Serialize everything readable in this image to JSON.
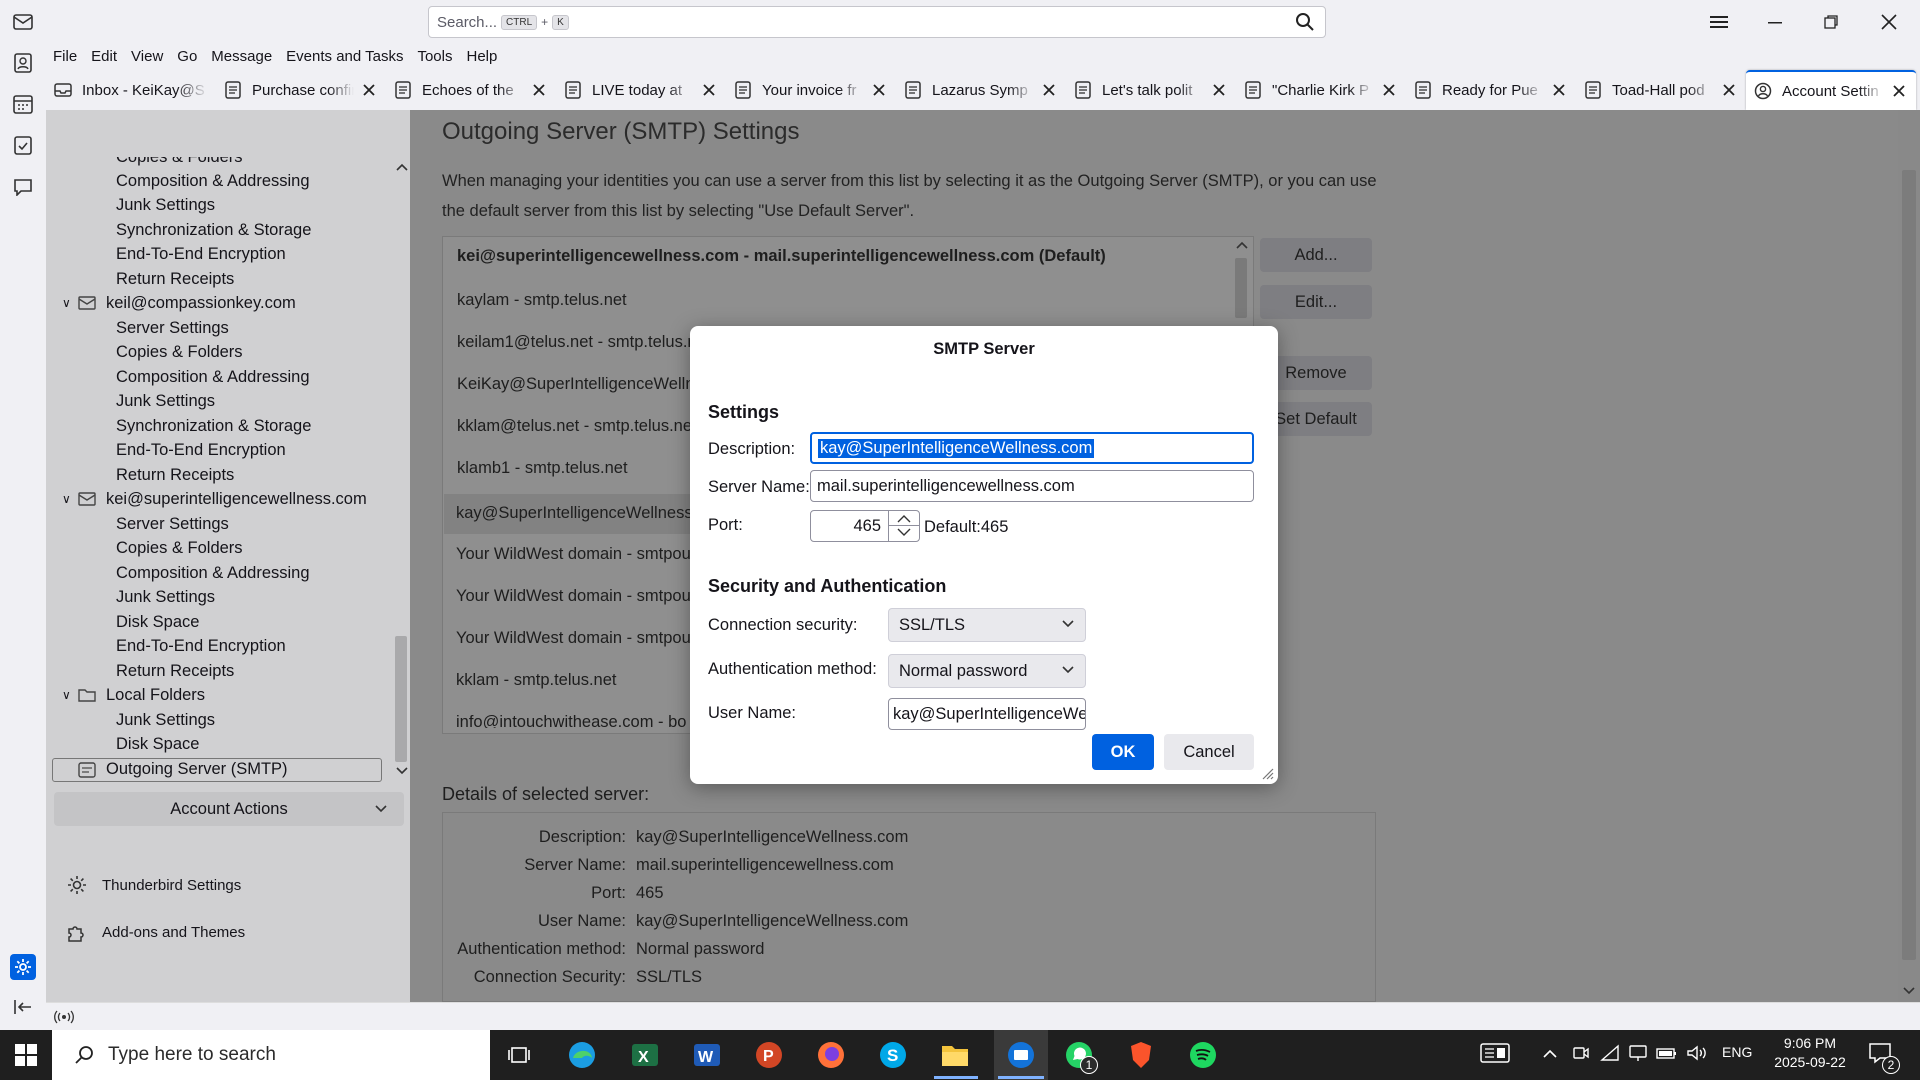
{
  "titlebar": {
    "search_placeholder": "Search...",
    "kbd_ctrl": "CTRL",
    "kbd_plus": "+",
    "kbd_k": "K"
  },
  "menu": [
    "File",
    "Edit",
    "View",
    "Go",
    "Message",
    "Events and Tasks",
    "Tools",
    "Help"
  ],
  "tabs": [
    {
      "label": "Inbox - KeiKay@S",
      "icon": "mail-icon"
    },
    {
      "label": "Purchase confirm",
      "icon": "message-icon"
    },
    {
      "label": "Echoes of the",
      "icon": "message-icon"
    },
    {
      "label": "LIVE today at",
      "icon": "message-icon"
    },
    {
      "label": "Your invoice fr",
      "icon": "message-icon"
    },
    {
      "label": "Lazarus Symp",
      "icon": "message-icon"
    },
    {
      "label": "Let's talk polit",
      "icon": "message-icon"
    },
    {
      "label": "\"Charlie Kirk P",
      "icon": "message-icon"
    },
    {
      "label": "Ready for Pue",
      "icon": "message-icon"
    },
    {
      "label": "Toad-Hall pod",
      "icon": "message-icon"
    },
    {
      "label": "Account Settin",
      "icon": "account-settings-icon",
      "active": true
    }
  ],
  "tree": {
    "items": [
      {
        "label": "Copies & Folders",
        "level": 2
      },
      {
        "label": "Composition & Addressing",
        "level": 2
      },
      {
        "label": "Junk Settings",
        "level": 2
      },
      {
        "label": "Synchronization & Storage",
        "level": 2
      },
      {
        "label": "End-To-End Encryption",
        "level": 2
      },
      {
        "label": "Return Receipts",
        "level": 2
      },
      {
        "label": "keil@compassionkey.com",
        "level": 1
      },
      {
        "label": "Server Settings",
        "level": 2
      },
      {
        "label": "Copies & Folders",
        "level": 2
      },
      {
        "label": "Composition & Addressing",
        "level": 2
      },
      {
        "label": "Junk Settings",
        "level": 2
      },
      {
        "label": "Synchronization & Storage",
        "level": 2
      },
      {
        "label": "End-To-End Encryption",
        "level": 2
      },
      {
        "label": "Return Receipts",
        "level": 2
      },
      {
        "label": "kei@superintelligencewellness.com",
        "level": 1
      },
      {
        "label": "Server Settings",
        "level": 2
      },
      {
        "label": "Copies & Folders",
        "level": 2
      },
      {
        "label": "Composition & Addressing",
        "level": 2
      },
      {
        "label": "Junk Settings",
        "level": 2
      },
      {
        "label": "Disk Space",
        "level": 2
      },
      {
        "label": "End-To-End Encryption",
        "level": 2
      },
      {
        "label": "Return Receipts",
        "level": 2
      },
      {
        "label": "Local Folders",
        "level": 1
      },
      {
        "label": "Junk Settings",
        "level": 2
      },
      {
        "label": "Disk Space",
        "level": 2
      },
      {
        "label": "Outgoing Server (SMTP)",
        "level": 1
      }
    ],
    "account_actions": "Account Actions",
    "thunderbird_settings": "Thunderbird Settings",
    "addons_themes": "Add-ons and Themes"
  },
  "pane": {
    "title": "Outgoing Server (SMTP) Settings",
    "description": "When managing your identities you can use a server from this list by selecting it as the Outgoing Server (SMTP), or you can use the default server from this list by selecting \"Use Default Server\".",
    "servers": [
      "kei@superintelligencewellness.com - mail.superintelligencewellness.com (Default)",
      "kaylam - smtp.telus.net",
      "keilam1@telus.net - smtp.telus.n",
      "KeiKay@SuperIntelligenceWellne",
      "kklam@telus.net - smtp.telus.ne",
      "klamb1 - smtp.telus.net",
      "kay@SuperIntelligenceWellness.",
      "Your WildWest domain - smtpou",
      "Your WildWest domain - smtpou",
      "Your WildWest domain - smtpou",
      "kklam - smtp.telus.net",
      "info@intouchwithease.com - bo"
    ],
    "buttons": {
      "add": "Add...",
      "edit": "Edit...",
      "remove": "Remove",
      "set_default": "Set Default"
    },
    "details_heading": "Details of selected server:",
    "details": [
      {
        "k": "Description:",
        "v": "kay@SuperIntelligenceWellness.com"
      },
      {
        "k": "Server Name:",
        "v": "mail.superintelligencewellness.com"
      },
      {
        "k": "Port:",
        "v": "465"
      },
      {
        "k": "User Name:",
        "v": "kay@SuperIntelligenceWellness.com"
      },
      {
        "k": "Authentication method:",
        "v": "Normal password"
      },
      {
        "k": "Connection Security:",
        "v": "SSL/TLS"
      }
    ]
  },
  "dialog": {
    "title": "SMTP Server",
    "settings_heading": "Settings",
    "description_label": "Description:",
    "description_value": "kay@SuperIntelligenceWellness.com",
    "server_name_label": "Server Name:",
    "server_name_value": "mail.superintelligencewellness.com",
    "port_label": "Port:",
    "port_value": "465",
    "port_default": "Default:465",
    "security_heading": "Security and Authentication",
    "connection_security_label": "Connection security:",
    "connection_security_value": "SSL/TLS",
    "auth_method_label": "Authentication method:",
    "auth_method_value": "Normal password",
    "user_name_label": "User Name:",
    "user_name_value": "kay@SuperIntelligenceWe",
    "ok": "OK",
    "cancel": "Cancel"
  },
  "taskbar": {
    "search_placeholder": "Type here to search",
    "language": "ENG",
    "time": "9:06 PM",
    "date": "2025-09-22",
    "whatsapp_badge": "1",
    "notifications_badge": "2"
  },
  "colors": {
    "accent": "#0061e0",
    "taskbar": "#1f1f1f",
    "dim_overlay": "#8a8a8a"
  }
}
